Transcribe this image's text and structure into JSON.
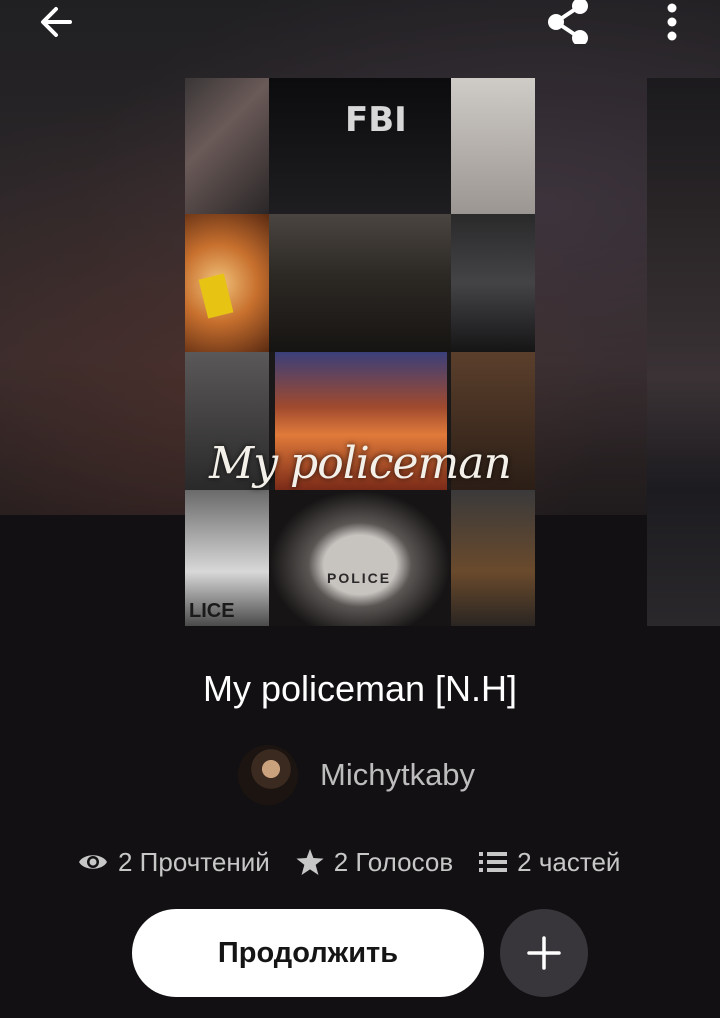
{
  "header": {
    "back_icon": "arrow-left-icon",
    "share_icon": "share-icon",
    "more_icon": "more-vertical-icon"
  },
  "cover": {
    "overlay_title": "My policeman",
    "badge_texts": [
      "FBI",
      "POLICE",
      "LICE"
    ]
  },
  "story": {
    "title": "My policeman [N.H]",
    "author": "Michytkaby"
  },
  "stats": {
    "reads": "2 Прочтений",
    "votes": "2 Голосов",
    "parts": "2 частей"
  },
  "actions": {
    "continue_label": "Продолжить",
    "add_icon": "plus-icon"
  },
  "colors": {
    "background": "#121012",
    "button_bg": "#ffffff",
    "add_button_bg": "#38363a",
    "muted_text": "#c7c7c7"
  }
}
